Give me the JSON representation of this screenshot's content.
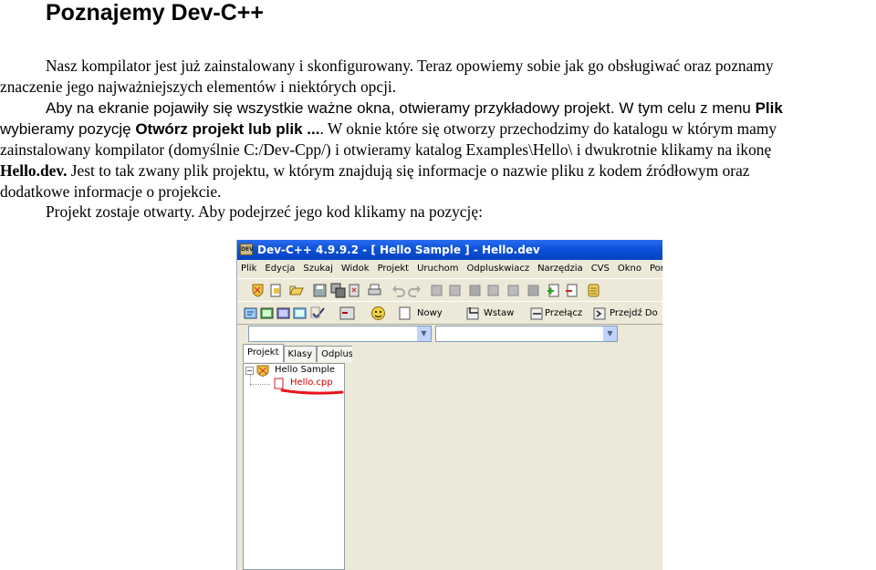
{
  "title": "Poznajemy Dev-C++",
  "p1_line1": "Nasz kompilator jest już zainstalowany i skonfigurowany. Teraz opowiemy sobie jak go obsługiwać oraz poznamy",
  "p1_line2": "znaczenie jego najważniejszych elementów i niektórych opcji.",
  "p2_line1_a": "Aby na ekranie pojawiły się wszystkie ważne okna, otwieramy przykładowy projekt. W tym celu z menu ",
  "p2_line1_b": "Plik",
  "p2_line2_a": "wybieramy pozycję ",
  "p2_line2_b": "Otwórz projekt lub plik ...",
  "p2_line2_c": ". W oknie które się otworzy przechodzimy do katalogu w którym mamy",
  "p2_line3": "zainstalowany kompilator (domyślnie C:/Dev-Cpp/) i otwieramy katalog Examples\\Hello\\ i dwukrotnie klikamy na ikonę",
  "p2_line4_a": "Hello.dev.",
  "p2_line4_b": " Jest to tak zwany plik projektu, w którym znajdują się informacje o nazwie pliku z kodem źródłowym oraz",
  "p2_line5": "dodatkowe informacje o projekcie.",
  "p3": "Projekt zostaje otwarty. Aby podejrzeć jego kod klikamy na pozycję:",
  "screenshot": {
    "window_title": "Dev-C++ 4.9.9.2  - [ Hello Sample ] - Hello.dev",
    "app_icon_text": "DEV",
    "menu": [
      "Plik",
      "Edycja",
      "Szukaj",
      "Widok",
      "Projekt",
      "Uruchom",
      "Odpluskwiacz",
      "Narzędzia",
      "CVS",
      "Okno",
      "Pomoc"
    ],
    "toolbar2_labels": {
      "new": "Nowy",
      "insert": "Wstaw",
      "toggle": "Przełącz",
      "goto": "Przejdź Do"
    },
    "tabs": [
      "Projekt",
      "Klasy",
      "Odplus"
    ],
    "tree_root": "Hello Sample",
    "tree_child": "Hello.cpp",
    "highlight_color": "#e8141b",
    "accent_color": "#0a4fd6"
  }
}
